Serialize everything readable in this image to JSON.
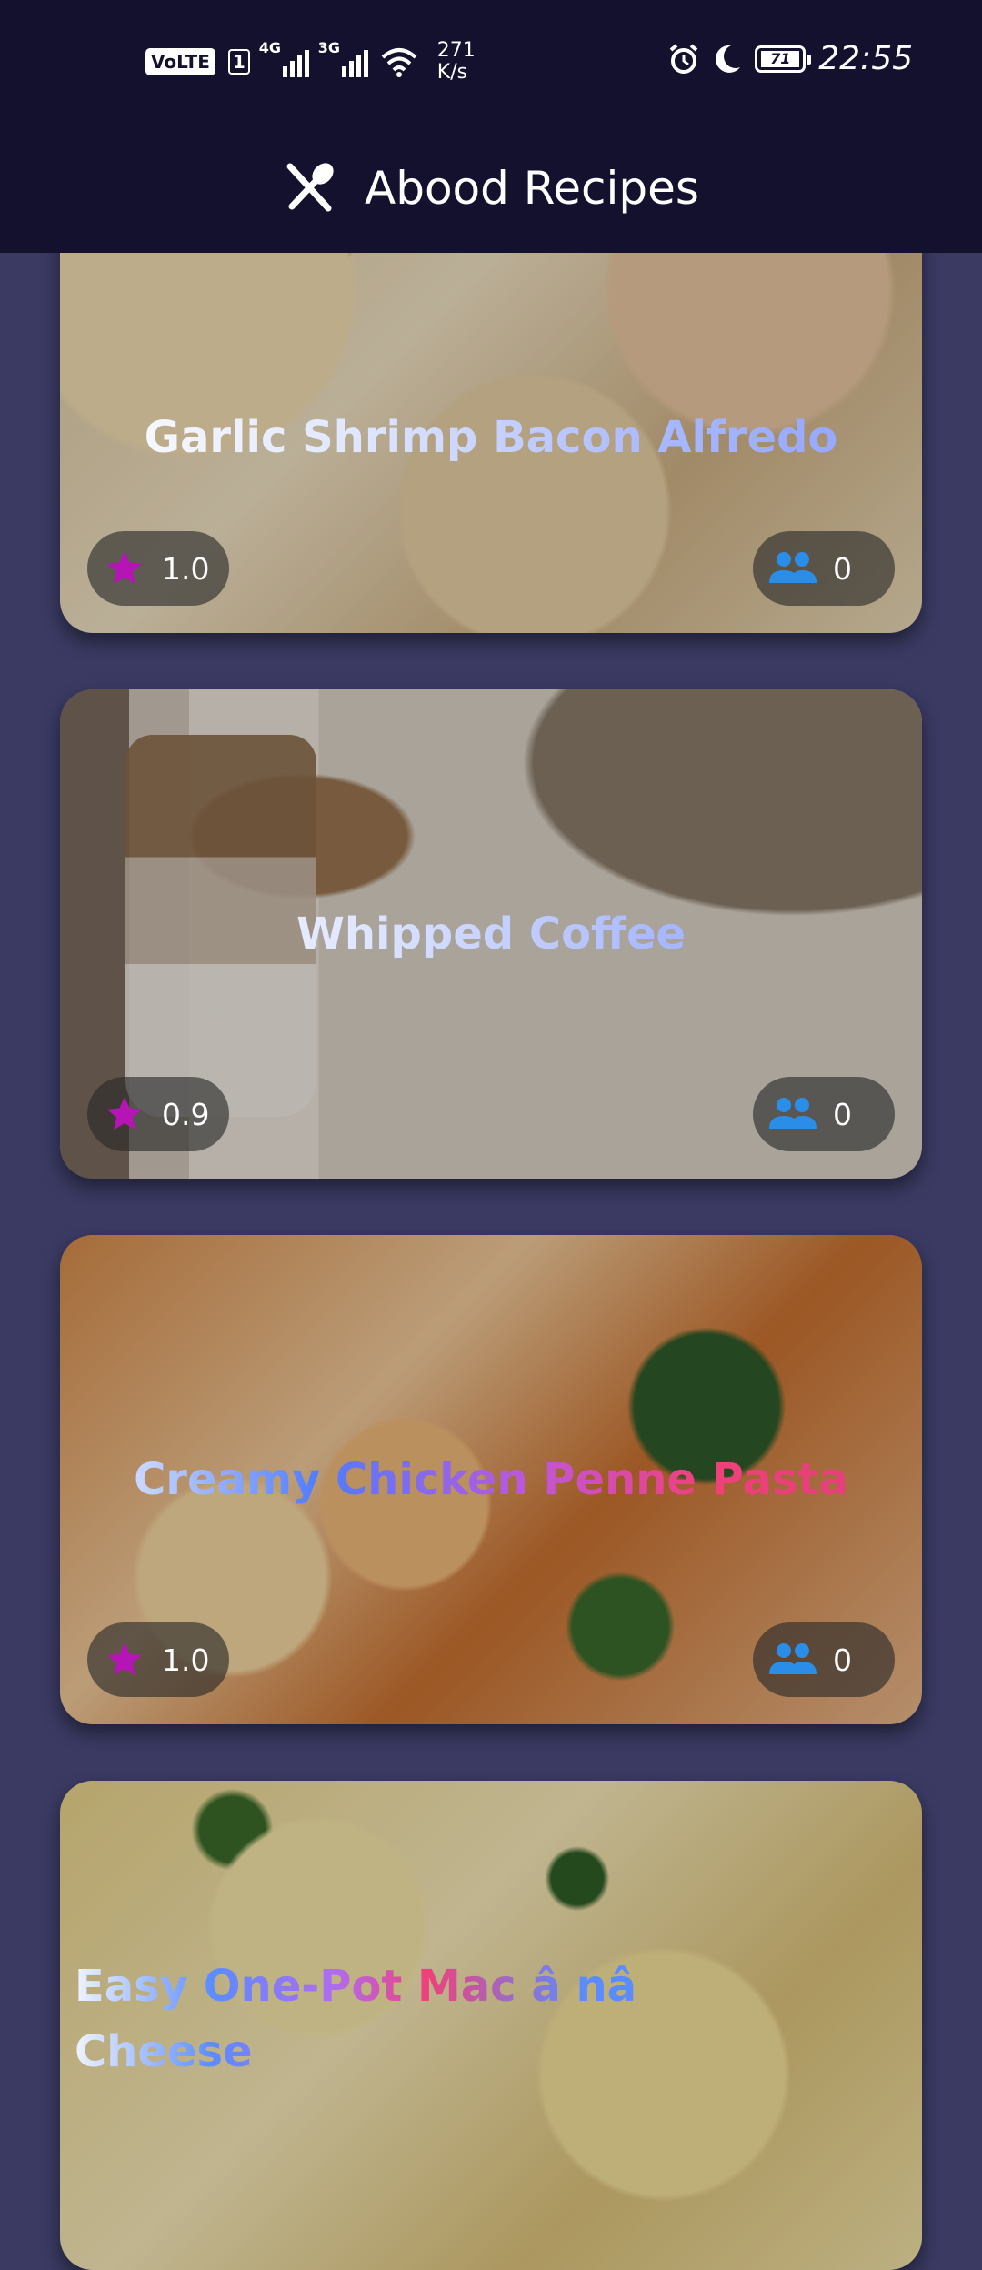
{
  "status_bar": {
    "volte": "VoLTE",
    "sim_slot": "1",
    "network1": "4G",
    "network2": "3G",
    "speed_value": "271",
    "speed_unit": "K/s",
    "battery": "71",
    "time": "22:55"
  },
  "app": {
    "title": "Abood Recipes",
    "logo_icon": "fork-spoon-icon"
  },
  "recipes": [
    {
      "name": "Garlic Shrimp Bacon Alfredo",
      "rating": "1.0",
      "users": "0"
    },
    {
      "name": "Whipped Coffee",
      "rating": "0.9",
      "users": "0"
    },
    {
      "name": "Creamy Chicken Penne Pasta",
      "rating": "1.0",
      "users": "0"
    },
    {
      "name": "Easy One-Pot Mac â  nâ Cheese",
      "rating": "",
      "users": ""
    }
  ],
  "colors": {
    "status_bar_bg": "#13112e",
    "page_bg": "#3a3a63",
    "star": "#b515b5",
    "users_icon": "#2a8ee8"
  }
}
